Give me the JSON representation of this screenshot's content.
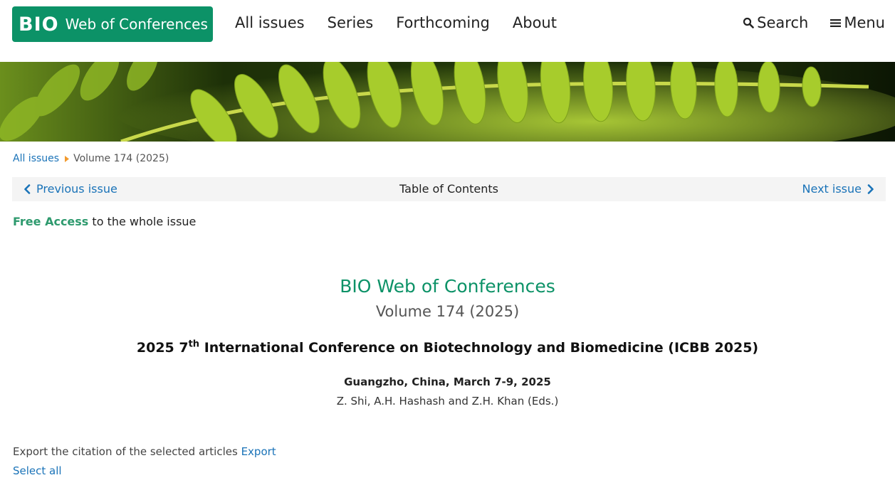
{
  "header": {
    "logo_bio": "BIO",
    "logo_rest": "Web of Conferences",
    "nav": [
      {
        "label": "All issues"
      },
      {
        "label": "Series"
      },
      {
        "label": "Forthcoming"
      },
      {
        "label": "About"
      }
    ],
    "search_label": "Search",
    "menu_label": "Menu"
  },
  "breadcrumb": {
    "root": "All issues",
    "current": "Volume 174 (2025)"
  },
  "toc_bar": {
    "previous": "Previous issue",
    "title": "Table of Contents",
    "next": "Next issue"
  },
  "free_access": {
    "label": "Free Access",
    "text": " to the whole issue"
  },
  "issue": {
    "journal": "BIO Web of Conferences",
    "volume": "Volume 174 (2025)",
    "conference_prefix": "2025 7",
    "conference_sup": "th",
    "conference_suffix": " International Conference on Biotechnology and Biomedicine (ICBB 2025)",
    "location": "Guangzho, China, March 7-9, 2025",
    "editors": "Z. Shi, A.H. Hashash and Z.H. Khan (Eds.)"
  },
  "export": {
    "text": "Export the citation of the selected articles ",
    "link": "Export",
    "select_all": "Select all"
  },
  "colors": {
    "brand_green": "#0c9267",
    "link_blue": "#1a73b8",
    "toc_bg": "#f4f4f4",
    "breadcrumb_arrow": "#f29a2e"
  },
  "icons": {
    "search": "search-icon",
    "menu": "hamburger-icon",
    "prev": "chevron-left-icon",
    "next": "chevron-right-icon",
    "breadcrumb_sep": "caret-right-icon"
  }
}
